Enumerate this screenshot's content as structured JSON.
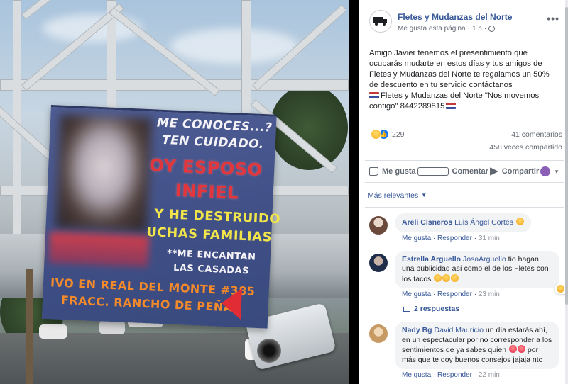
{
  "banner": {
    "line1": "ME CONOCES...?",
    "line2": "TEN CUIDADO.",
    "line3": "OY ESPOSO",
    "line4": "INFIEL",
    "line5": "Y HE DESTRUIDO",
    "line6": "UCHAS FAMILIAS",
    "line7": "**ME ENCANTAN",
    "line8": "LAS CASADAS",
    "line9": "IVO EN REAL DEL MONTE #385",
    "line10": "FRACC. RANCHO DE PEÑA"
  },
  "post": {
    "page_name": "Fletes y Mudanzas del Norte",
    "liked_label": "Me gusta esta página",
    "separator": "·",
    "time": "1 h",
    "options_icon": "more-options-icon",
    "body_before_flag": "Amigo Javier tenemos el presentimiento que ocuparás mudarte en estos días y tus amigos de Fletes y Mudanzas del Norte te regalamos un 50% de descuento en tu servicio contáctanos ",
    "body_slogan": "Fletes y Mudanzas del Norte \"Nos movemos contigo\" 8442289815",
    "reaction_count": "229",
    "comments_count": "41 comentarios",
    "shares_count": "458 veces compartido",
    "actions": {
      "like": "Me gusta",
      "comment": "Comentar",
      "share": "Compartir"
    },
    "sort_label": "Más relevantes",
    "colors": {
      "link": "#385898",
      "like_blue": "#1877f2",
      "bubble": "#f2f3f5"
    }
  },
  "comments": [
    {
      "name": "Areli Cisneros",
      "tag": "Luis Ángel Cortés",
      "text": "",
      "like": "Me gusta",
      "reply": "Responder",
      "time": "31 min"
    },
    {
      "name": "Estrella Arguello",
      "tag": "JosaArguello",
      "text": " tio hagan una publicidad así como el de los Fletes con los tacos",
      "like": "Me gusta",
      "reply": "Responder",
      "time": "23 min",
      "reactions": "1",
      "replies_label": "2 respuestas"
    },
    {
      "name": "Nady Bg",
      "tag": "David Mauricio",
      "text": " un día estarás ahí, en un espectacular por no corresponder a los sentimientos de ya sabes quien",
      "text2": " por más que te doy buenos consejos jajaja ntc",
      "like": "Me gusta",
      "reply": "Responder",
      "time": "22 min"
    }
  ]
}
